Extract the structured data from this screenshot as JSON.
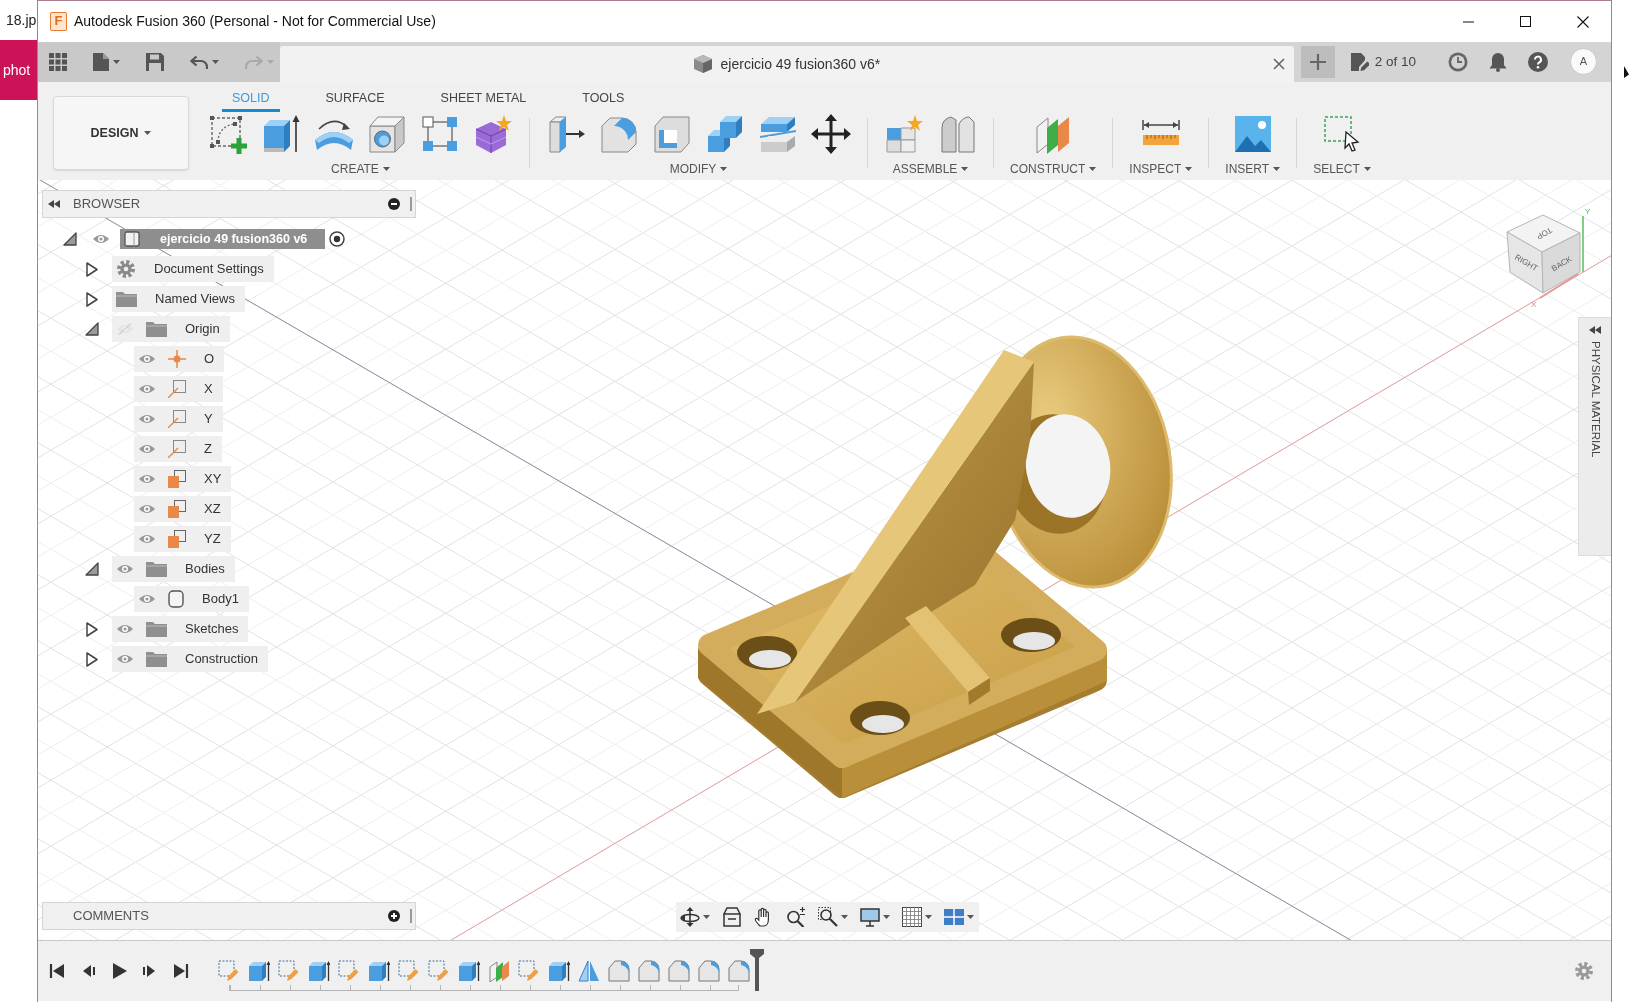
{
  "desktop": {
    "file_name": "18.jp",
    "taskbar_label": "phot"
  },
  "window": {
    "app_logo": "F",
    "title": "Autodesk Fusion 360 (Personal - Not for Commercial Use)"
  },
  "quick_access": [
    {
      "kind": "undo",
      "disabled": false
    },
    {
      "kind": "redo",
      "disabled": true
    }
  ],
  "document_tab": {
    "title": "ejercicio 49 fusion360 v6*",
    "job_status": "2 of 10",
    "user_initial": "A"
  },
  "toolbar": {
    "workspace": "DESIGN",
    "tabs": [
      {
        "label": "SOLID",
        "selected": true
      },
      {
        "label": "SURFACE",
        "selected": false
      },
      {
        "label": "SHEET METAL",
        "selected": false
      },
      {
        "label": "TOOLS",
        "selected": false
      }
    ],
    "groups": [
      {
        "label": "CREATE"
      },
      {
        "label": "MODIFY"
      },
      {
        "label": "ASSEMBLE"
      },
      {
        "label": "CONSTRUCT"
      },
      {
        "label": "INSPECT"
      },
      {
        "label": "INSERT"
      },
      {
        "label": "SELECT"
      }
    ]
  },
  "browser": {
    "title": "BROWSER",
    "root": {
      "label": "ejercicio 49 fusion360 v6",
      "expanded": true,
      "visible": true,
      "active": true
    },
    "items": [
      {
        "kind": "settings",
        "label": "Document Settings",
        "expanded": false
      },
      {
        "kind": "folder",
        "label": "Named Views",
        "expanded": false
      },
      {
        "kind": "folder",
        "label": "Origin",
        "expanded": true,
        "visible": false,
        "children": [
          {
            "kind": "point",
            "label": "O",
            "visible": true
          },
          {
            "kind": "axis",
            "label": "X",
            "visible": true
          },
          {
            "kind": "axis",
            "label": "Y",
            "visible": true
          },
          {
            "kind": "axis",
            "label": "Z",
            "visible": true
          },
          {
            "kind": "plane",
            "label": "XY",
            "visible": true
          },
          {
            "kind": "plane",
            "label": "XZ",
            "visible": true
          },
          {
            "kind": "plane",
            "label": "YZ",
            "visible": true
          }
        ]
      },
      {
        "kind": "folder",
        "label": "Bodies",
        "expanded": true,
        "visible": true,
        "children": [
          {
            "kind": "body",
            "label": "Body1",
            "visible": true
          }
        ]
      },
      {
        "kind": "folder",
        "label": "Sketches",
        "expanded": false,
        "visible": true
      },
      {
        "kind": "folder",
        "label": "Construction",
        "expanded": false,
        "visible": true
      }
    ]
  },
  "view_cube": {
    "faces": [
      "TOP",
      "RIGHT",
      "BACK"
    ],
    "axes": [
      "X",
      "Y"
    ]
  },
  "side_panel": {
    "title": "PHYSICAL MATERIAL"
  },
  "comments": {
    "title": "COMMENTS"
  }
}
